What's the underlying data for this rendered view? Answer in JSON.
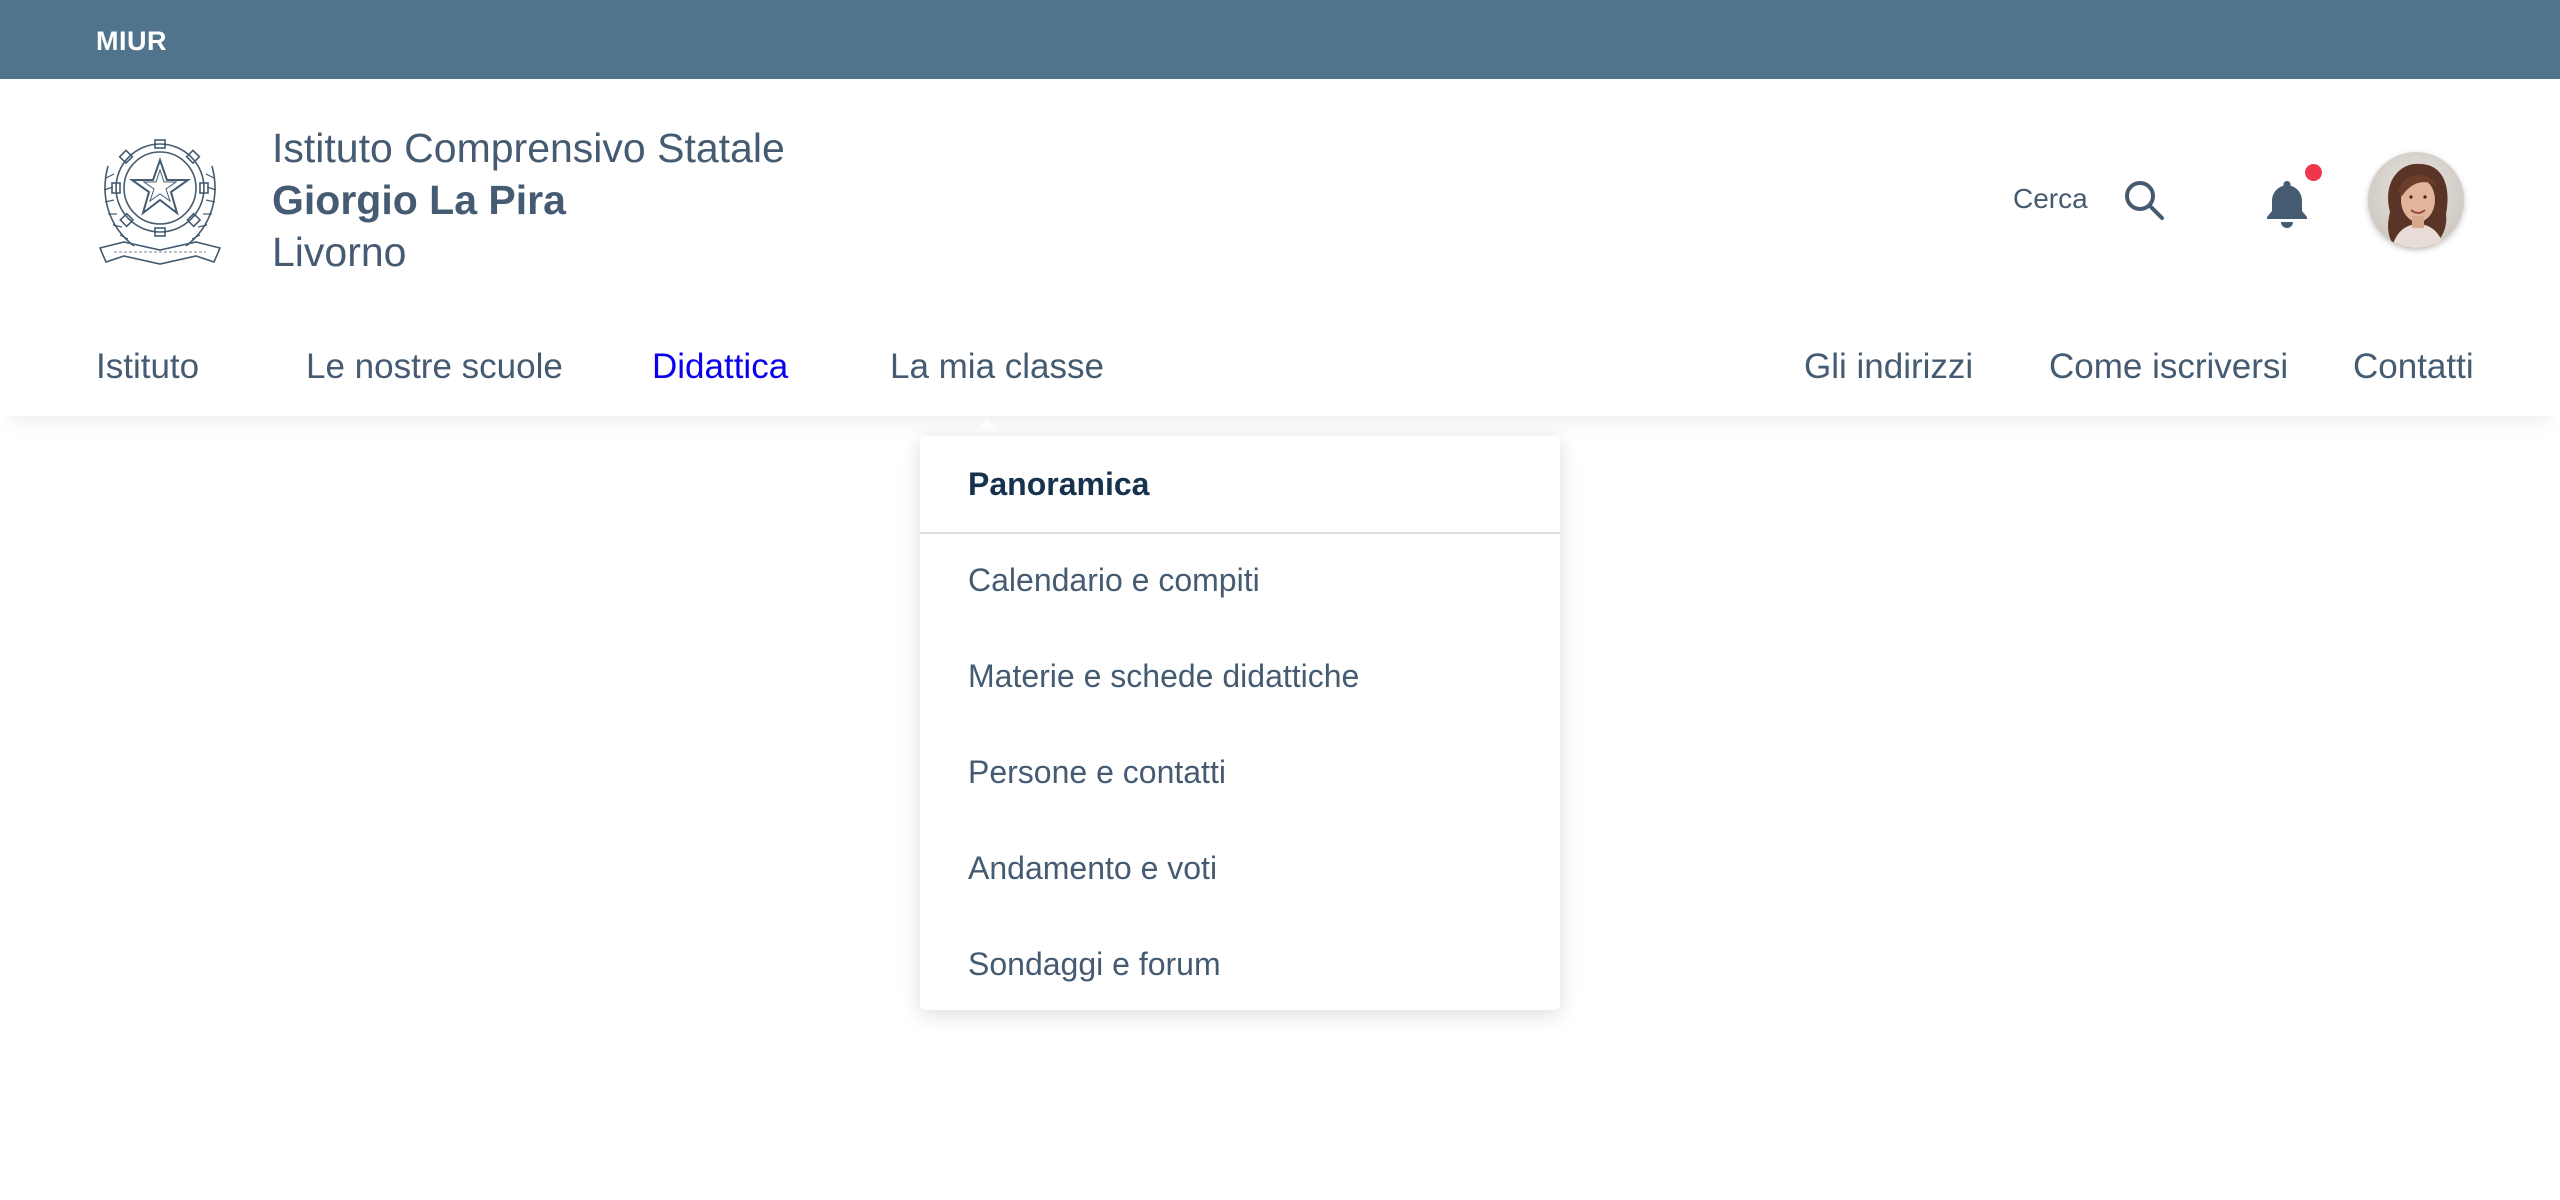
{
  "topbar": {
    "label": "MIUR"
  },
  "header": {
    "brand_line1": "Istituto Comprensivo Statale",
    "brand_line2": "Giorgio La Pira",
    "brand_line3": "Livorno",
    "search_label": "Cerca",
    "notification_badge_color": "#f0364f"
  },
  "nav": {
    "items": [
      {
        "label": "Istituto"
      },
      {
        "label": "Le nostre scuole"
      },
      {
        "label": "Didattica"
      },
      {
        "label": "La mia classe"
      },
      {
        "label": "Gli indirizzi"
      },
      {
        "label": "Come iscriversi"
      },
      {
        "label": "Contatti"
      }
    ],
    "active_color": "#0b00ed"
  },
  "dropdown": {
    "header": "Panoramica",
    "items": [
      {
        "label": "Calendario e compiti"
      },
      {
        "label": "Materie e schede didattiche"
      },
      {
        "label": "Persone e contatti"
      },
      {
        "label": "Andamento e voti"
      },
      {
        "label": "Sondaggi e forum"
      }
    ]
  },
  "colors": {
    "topbar": "#50748c",
    "text": "#455b71",
    "heading": "#17324d"
  }
}
